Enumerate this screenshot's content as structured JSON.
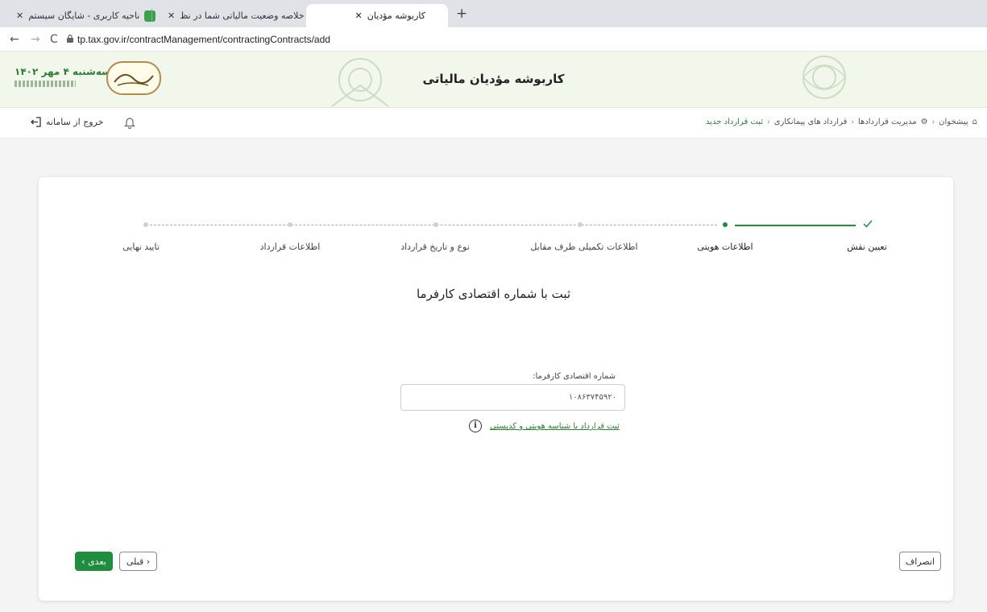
{
  "browser": {
    "tabs": [
      {
        "title": "کاربوشه مؤدیان",
        "active": true
      },
      {
        "title": "خلاصه وضعیت مالیاتی شما در نظ",
        "active": false
      },
      {
        "title": "ناحیه کاربری - شایگان سیستم",
        "active": false
      }
    ],
    "url": "tp.tax.gov.ir/contractManagement/contractingContracts/add"
  },
  "header": {
    "site_title": "کاربوشه مؤدیان مالیاتی",
    "date": "سه‌شنبه ۴ مهر ۱۴۰۲"
  },
  "toolbar": {
    "logout_label": "خروج از سامانه",
    "breadcrumb": [
      "پیشخوان",
      "مدیریت قراردادها",
      "قرارداد های پیمانکاری",
      "ثبت قرارداد جدید"
    ]
  },
  "stepper": {
    "steps": [
      "تعیین نقش",
      "اطلاعات هویتی",
      "اطلاعات تکمیلی طرف مقابل",
      "نوع و تاریخ قرارداد",
      "اطلاعات قرارداد",
      "تایید نهایی"
    ],
    "completed": 1,
    "current": 2
  },
  "form": {
    "title": "ثبت با شماره اقتصادی کارفرما",
    "field_label": "شماره اقتصادی کارفرما:",
    "field_value": "۱۰۸۶۳۷۴۵۹۲۰",
    "alt_link": "ثبت قرارداد با شناسه هویتی و کدپستی"
  },
  "buttons": {
    "next": "بعدی ›",
    "prev": "‹ قبلی",
    "cancel": "انصراف"
  },
  "colors": {
    "accent": "#1e8e3e",
    "header_bg": "#f2f7ec"
  }
}
